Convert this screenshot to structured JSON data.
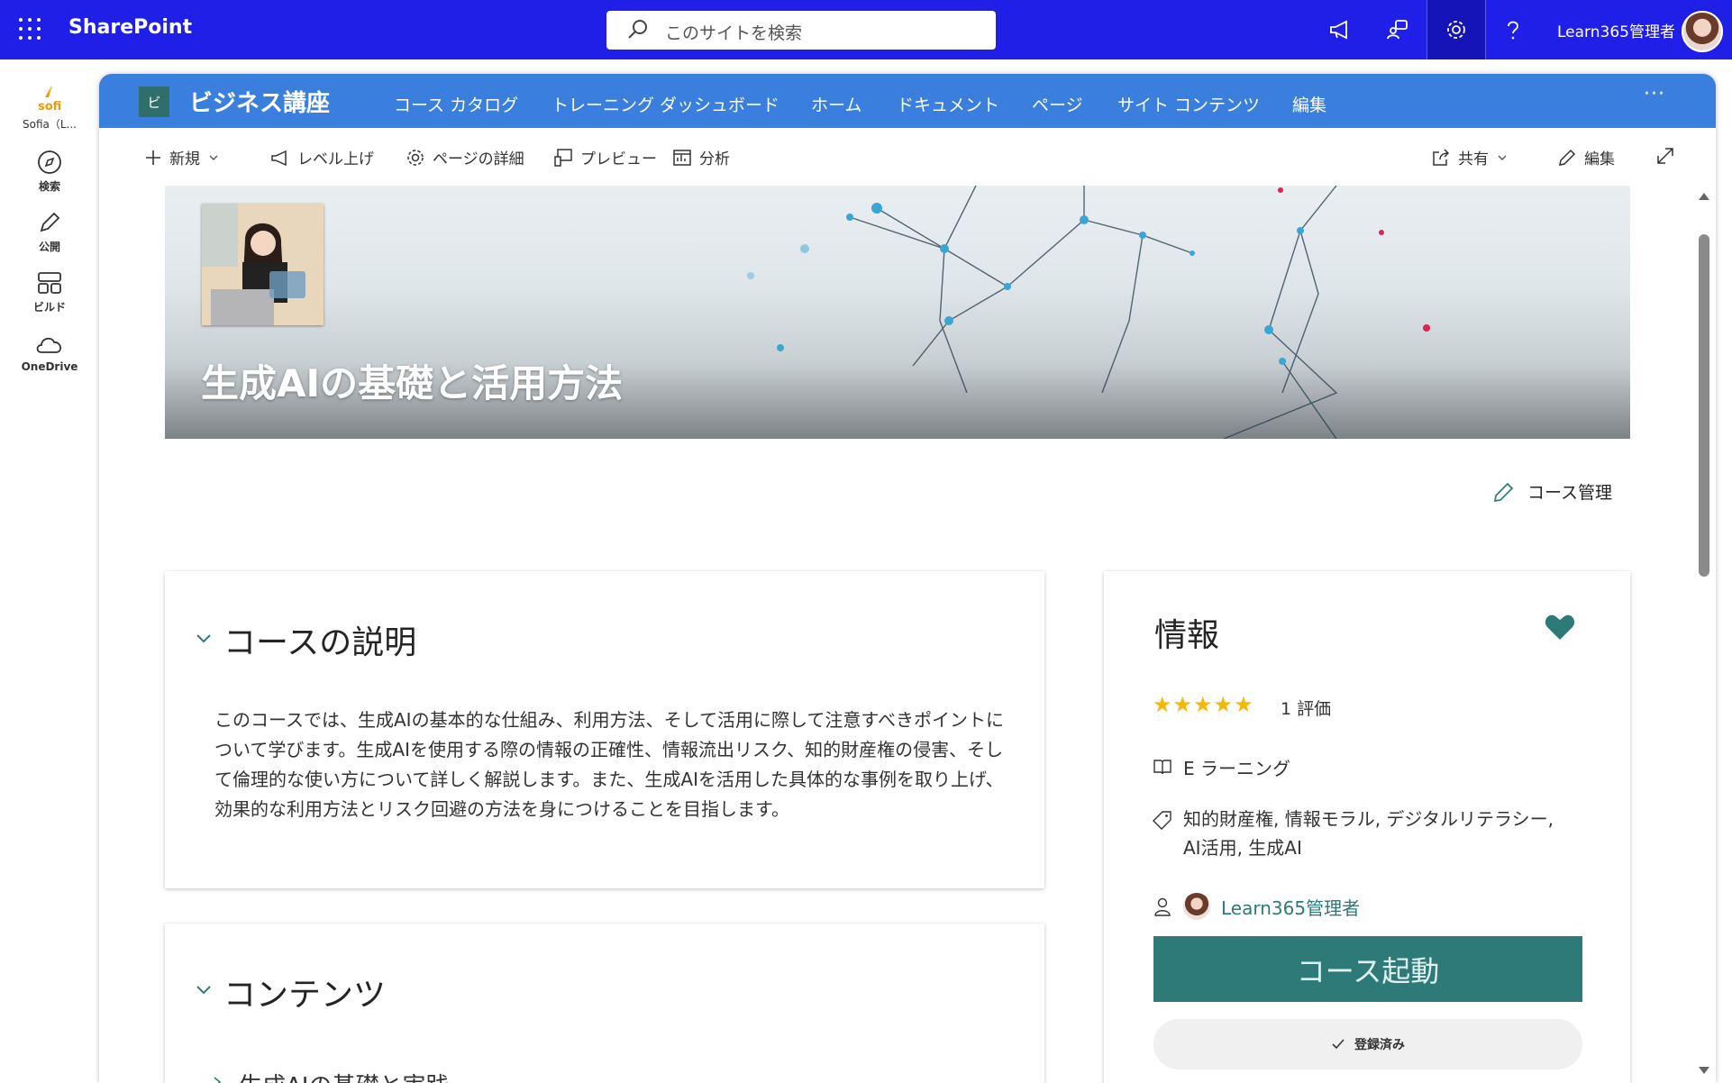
{
  "suitebar": {
    "app_name": "SharePoint",
    "search_placeholder": "このサイトを検索",
    "user_name": "Learn365管理者"
  },
  "rail": {
    "items": [
      {
        "label": "Sofia（L...",
        "icon": "sofia-logo-icon"
      },
      {
        "label": "検索",
        "icon": "compass-icon"
      },
      {
        "label": "公開",
        "icon": "pencil-icon"
      },
      {
        "label": "ビルド",
        "icon": "build-icon"
      },
      {
        "label": "OneDrive",
        "icon": "cloud-icon"
      }
    ]
  },
  "site": {
    "logo_letter": "ビ",
    "title": "ビジネス講座",
    "nav": [
      "コース カタログ",
      "トレーニング ダッシュボード",
      "ホーム",
      "ドキュメント",
      "ページ",
      "サイト コンテンツ",
      "編集"
    ],
    "more": "···"
  },
  "commands": {
    "new": "新規",
    "level_up": "レベル上げ",
    "page_details": "ページの詳細",
    "preview": "プレビュー",
    "analytics": "分析",
    "share": "共有",
    "edit": "編集"
  },
  "hero": {
    "title": "生成AIの基礎と活用方法"
  },
  "course_manage": "コース管理",
  "description": {
    "heading": "コースの説明",
    "body": "このコースでは、生成AIの基本的な仕組み、利用方法、そして活用に際して注意すべきポイントについて学びます。生成AIを使用する際の情報の正確性、情報流出リスク、知的財産権の侵害、そして倫理的な使い方について詳しく解説します。また、生成AIを活用した具体的な事例を取り上げ、効果的な利用方法とリスク回避の方法を身につけることを目指します。"
  },
  "contents": {
    "heading": "コンテンツ",
    "first_item": "生成AIの基礎と実践"
  },
  "info": {
    "heading": "情報",
    "stars": "★★★★★",
    "rating_value": 5,
    "rating_text": "1 評価",
    "type": "E ラーニング",
    "tags_line1": "知的財産権, 情報モラル, デジタルリテラシー,",
    "tags_line2": "AI活用, 生成AI",
    "owner": "Learn365管理者",
    "launch_label": "コース起動",
    "enrolled_label": "登録済み",
    "accent_color": "#2e7a78"
  },
  "colors": {
    "suitebar": "#1f1fe8",
    "site_header": "#3b7fde",
    "star": "#f5b80a",
    "link": "#2e7a78"
  }
}
